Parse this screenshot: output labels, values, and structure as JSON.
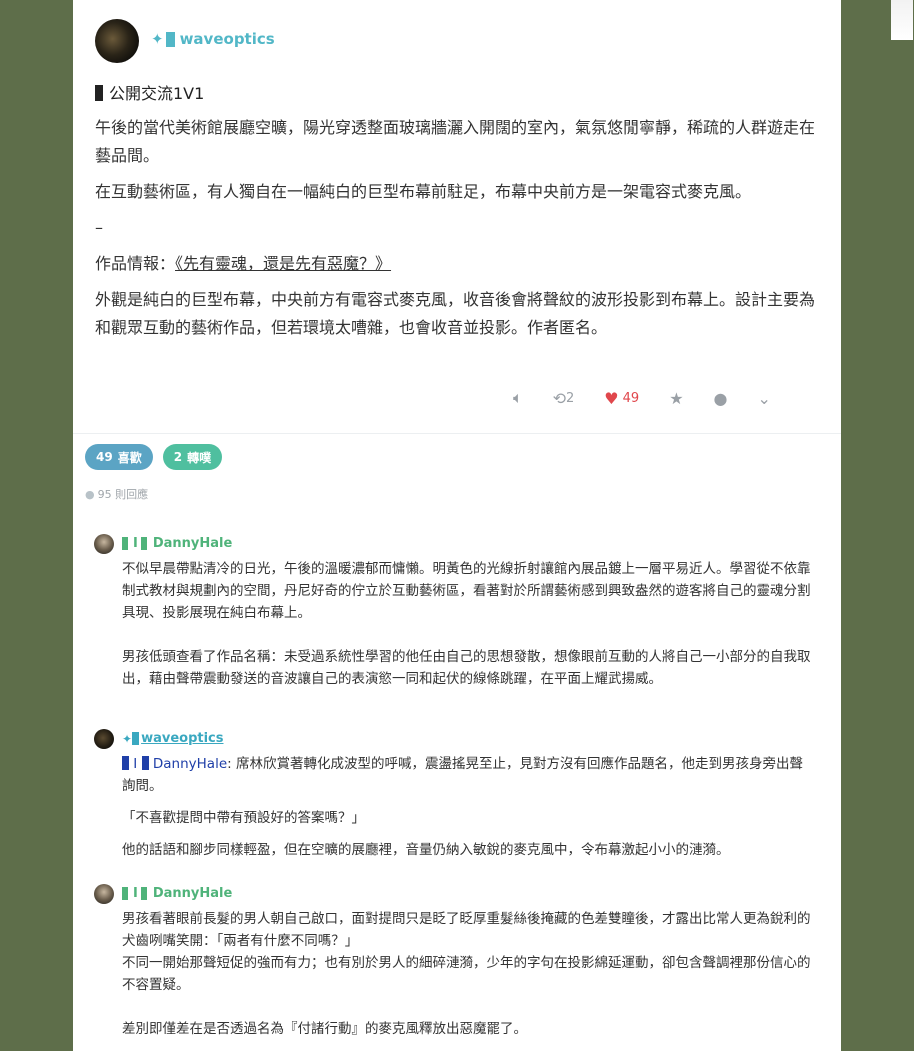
{
  "post": {
    "author": "waveoptics",
    "author_icon": "sparkle-icon",
    "title": "公開交流1V1",
    "paragraphs": [
      "午後的當代美術館展廳空曠，陽光穿透整面玻璃牆灑入開闊的室內，氣氛悠閒寧靜，稀疏的人群遊走在藝品間。",
      "在互動藝術區，有人獨自在一幅純白的巨型布幕前駐足，布幕中央前方是一架電容式麥克風。"
    ],
    "dash": "–",
    "work_label": "作品情報：",
    "work_title": "《先有靈魂，還是先有惡魔？》",
    "work_desc": "外觀是純白的巨型布幕，中央前方有電容式麥克風，收音後會將聲紋的波形投影到布幕上。設計主要為和觀眾互動的藝術作品，但若環境太嘈雜，也會收音並投影。作者匿名。"
  },
  "actions": {
    "reblog_count": "2",
    "likes_count": "49"
  },
  "stats": {
    "likes_num": "49",
    "likes_label": "喜歡",
    "reblogs_num": "2",
    "reblogs_label": "轉噗",
    "replies_num": "95",
    "replies_label": "則回應"
  },
  "comments": [
    {
      "author": "DannyHale",
      "sep": "I",
      "paragraphs": [
        "不似早晨帶點清冷的日光，午後的溫暖濃郁而慵懶。明黃色的光線折射讓館內展品鍍上一層平易近人。學習從不依靠制式教材與規劃內的空間，丹尼好奇的佇立於互動藝術區，看著對於所謂藝術感到興致盎然的遊客將自己的靈魂分割具現、投影展現在純白布幕上。",
        "男孩低頭查看了作品名稱：未受過系統性學習的他任由自己的思想發散，想像眼前互動的人將自己一小部分的自我取出，藉由聲帶震動發送的音波讓自己的表演慾一同和起伏的線條跳躍，在平面上耀武揚威。"
      ]
    },
    {
      "author": "waveoptics",
      "mention_name": "DannyHale",
      "mention_sep": "I",
      "mention_text": ": 席林欣賞著轉化成波型的呼喊，震盪搖晃至止，見對方沒有回應作品題名，他走到男孩身旁出聲詢問。",
      "quote": "「不喜歡提問中帶有預設好的答案嗎？」",
      "last": "他的話語和腳步同樣輕盈，但在空曠的展廳裡，音量仍納入敏銳的麥克風中，令布幕激起小小的漣漪。"
    },
    {
      "author": "DannyHale",
      "sep": "I",
      "lines": [
        "男孩看著眼前長髮的男人朝自己啟口，面對提問只是眨了眨厚重髮絲後掩藏的色差雙瞳後，才露出比常人更為銳利的犬齒咧嘴笑開：「兩者有什麼不同嗎？」",
        "不同一開始那聲短促的強而有力；也有別於男人的細碎漣漪，少年的字句在投影綿延運動，卻包含聲調裡那份信心的不容置疑。"
      ],
      "final": "差別即僅差在是否透過名為『付諸行動』的麥克風釋放出惡魔罷了。"
    }
  ],
  "colors": {
    "background": "#5e6e4a",
    "teal": "#52b7c7",
    "green": "#4fb37a",
    "heart": "#e0474c",
    "mention": "#1f3fa8"
  }
}
